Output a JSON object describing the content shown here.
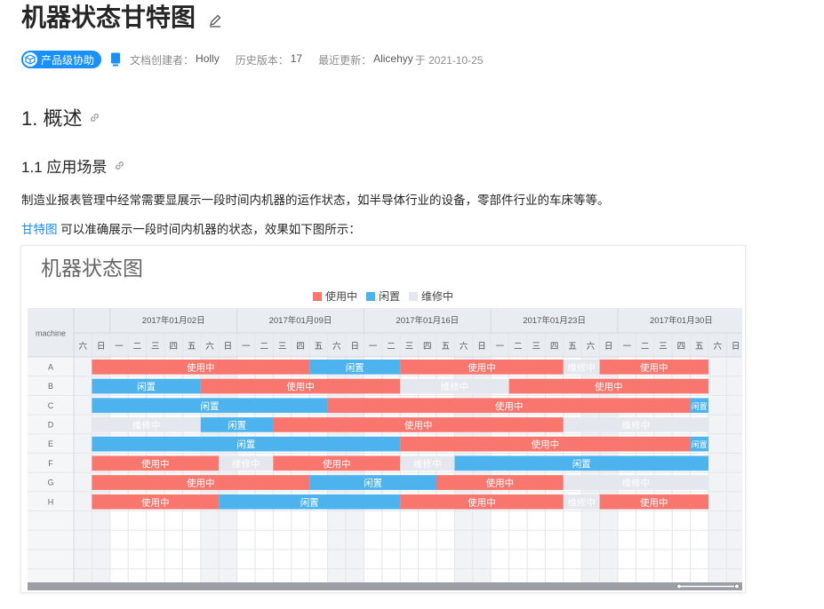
{
  "doc": {
    "title": "机器状态甘特图",
    "badge": "产品级协助",
    "creator_label": "文档创建者：",
    "creator": "Holly",
    "versions_label": "历史版本：",
    "versions": "17",
    "updated_label": "最近更新：",
    "updated_by": "Alicehyy",
    "updated_at": "于 2021-10-25"
  },
  "headings": {
    "h1": "1. 概述",
    "h2": "1.1 应用场景"
  },
  "paragraphs": {
    "p1": "制造业报表管理中经常需要显展示一段时间内机器的运作状态，如半导体行业的设备，零部件行业的车床等等。",
    "p2_link": "甘特图",
    "p2_text": " 可以准确展示一段时间内机器的状态，效果如下图所示："
  },
  "colors": {
    "accent": "#1890ff",
    "in_use": "#f8766d",
    "idle": "#4db3ee",
    "maintenance": "#e4e7ed"
  },
  "chart_data": {
    "type": "gantt",
    "title": "机器状态图",
    "row_header": "machine",
    "legend": [
      {
        "name": "使用中",
        "color": "#f8766d"
      },
      {
        "name": "闲置",
        "color": "#4db3ee"
      },
      {
        "name": "维修中",
        "color": "#e4e7ed"
      }
    ],
    "week_labels": [
      "2017年01月02日",
      "2017年01月09日",
      "2017年01月16日",
      "2017年01月23日",
      "2017年01月30日"
    ],
    "day_labels": [
      "六",
      "日",
      "一",
      "二",
      "三",
      "四",
      "五",
      "六",
      "日",
      "一",
      "二",
      "三",
      "四",
      "五",
      "六",
      "日",
      "一",
      "二",
      "三",
      "四",
      "五",
      "六",
      "日",
      "一",
      "二",
      "三",
      "四",
      "五",
      "六",
      "日",
      "一",
      "二",
      "三",
      "四",
      "五",
      "六",
      "日"
    ],
    "start_date": "2016-12-31",
    "machines": [
      "A",
      "B",
      "C",
      "D",
      "E",
      "F",
      "G",
      "H"
    ],
    "tasks": [
      {
        "machine": "A",
        "status": "使用中",
        "start": "2017-01-01",
        "end": "2017-01-13"
      },
      {
        "machine": "A",
        "status": "闲置",
        "start": "2017-01-13",
        "end": "2017-01-18"
      },
      {
        "machine": "A",
        "status": "使用中",
        "start": "2017-01-18",
        "end": "2017-01-27"
      },
      {
        "machine": "A",
        "status": "维修中",
        "start": "2017-01-27",
        "end": "2017-01-29"
      },
      {
        "machine": "A",
        "status": "使用中",
        "start": "2017-01-29",
        "end": "2017-02-04"
      },
      {
        "machine": "B",
        "status": "闲置",
        "start": "2017-01-01",
        "end": "2017-01-07"
      },
      {
        "machine": "B",
        "status": "使用中",
        "start": "2017-01-07",
        "end": "2017-01-18"
      },
      {
        "machine": "B",
        "status": "维修中",
        "start": "2017-01-18",
        "end": "2017-01-24"
      },
      {
        "machine": "B",
        "status": "使用中",
        "start": "2017-01-24",
        "end": "2017-02-04"
      },
      {
        "machine": "C",
        "status": "闲置",
        "start": "2017-01-01",
        "end": "2017-01-14"
      },
      {
        "machine": "C",
        "status": "使用中",
        "start": "2017-01-14",
        "end": "2017-02-03"
      },
      {
        "machine": "C",
        "status": "闲置",
        "start": "2017-02-03",
        "end": "2017-02-04"
      },
      {
        "machine": "D",
        "status": "维修中",
        "start": "2017-01-01",
        "end": "2017-01-07"
      },
      {
        "machine": "D",
        "status": "闲置",
        "start": "2017-01-07",
        "end": "2017-01-11"
      },
      {
        "machine": "D",
        "status": "使用中",
        "start": "2017-01-11",
        "end": "2017-01-27"
      },
      {
        "machine": "D",
        "status": "维修中",
        "start": "2017-01-27",
        "end": "2017-02-04"
      },
      {
        "machine": "E",
        "status": "闲置",
        "start": "2017-01-01",
        "end": "2017-01-18"
      },
      {
        "machine": "E",
        "status": "使用中",
        "start": "2017-01-18",
        "end": "2017-02-03"
      },
      {
        "machine": "E",
        "status": "闲置",
        "start": "2017-02-03",
        "end": "2017-02-04"
      },
      {
        "machine": "F",
        "status": "使用中",
        "start": "2017-01-01",
        "end": "2017-01-08"
      },
      {
        "machine": "F",
        "status": "维修中",
        "start": "2017-01-08",
        "end": "2017-01-11"
      },
      {
        "machine": "F",
        "status": "使用中",
        "start": "2017-01-11",
        "end": "2017-01-18"
      },
      {
        "machine": "F",
        "status": "维修中",
        "start": "2017-01-18",
        "end": "2017-01-21"
      },
      {
        "machine": "F",
        "status": "闲置",
        "start": "2017-01-21",
        "end": "2017-02-04"
      },
      {
        "machine": "G",
        "status": "使用中",
        "start": "2017-01-01",
        "end": "2017-01-13"
      },
      {
        "machine": "G",
        "status": "闲置",
        "start": "2017-01-13",
        "end": "2017-01-20"
      },
      {
        "machine": "G",
        "status": "使用中",
        "start": "2017-01-20",
        "end": "2017-01-27"
      },
      {
        "machine": "G",
        "status": "维修中",
        "start": "2017-01-27",
        "end": "2017-02-04"
      },
      {
        "machine": "H",
        "status": "使用中",
        "start": "2017-01-01",
        "end": "2017-01-08"
      },
      {
        "machine": "H",
        "status": "闲置",
        "start": "2017-01-08",
        "end": "2017-01-18"
      },
      {
        "machine": "H",
        "status": "使用中",
        "start": "2017-01-18",
        "end": "2017-01-27"
      },
      {
        "machine": "H",
        "status": "维修中",
        "start": "2017-01-27",
        "end": "2017-01-29"
      },
      {
        "machine": "H",
        "status": "使用中",
        "start": "2017-01-29",
        "end": "2017-02-04"
      }
    ]
  }
}
